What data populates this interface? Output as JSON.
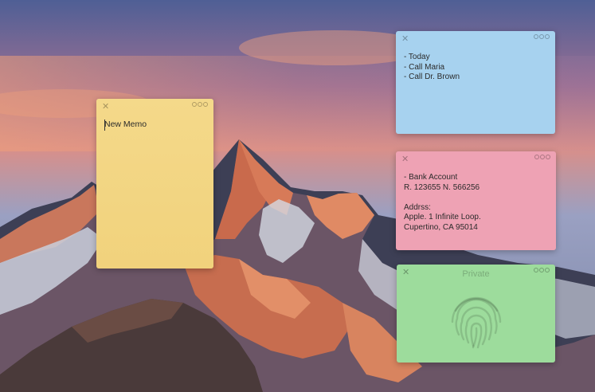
{
  "notes": {
    "yellow": {
      "text": "New Memo"
    },
    "blue": {
      "text": "- Today\n- Call Maria\n- Call Dr. Brown"
    },
    "pink": {
      "text": "- Bank Account\nR. 123655 N. 566256\n\nAddrss:\nApple. 1 Infinite Loop.\nCupertino, CA 95014"
    },
    "green": {
      "title": "Private"
    }
  },
  "icons": {
    "close": "close-icon",
    "more": "more-options-icon",
    "lock": "fingerprint-icon"
  },
  "colors": {
    "yellow": "#f4d98a",
    "blue": "#a7d2ef",
    "pink": "#eea2b4",
    "green": "#9ddc9c"
  }
}
